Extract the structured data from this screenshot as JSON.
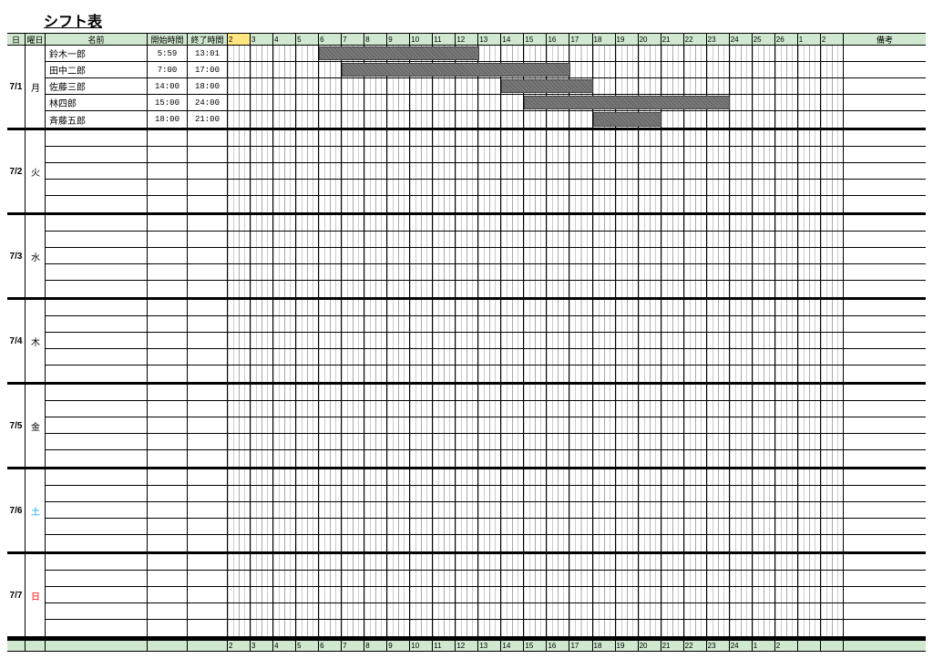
{
  "title": "シフト表",
  "headers": {
    "date": "日",
    "dow": "曜日",
    "name": "名前",
    "start": "開始時間",
    "end": "終了時間",
    "remark": "備考"
  },
  "timeline": {
    "start_hour": 2,
    "end_hour": 26,
    "hour_labels": [
      "2",
      "3",
      "4",
      "5",
      "6",
      "7",
      "8",
      "9",
      "10",
      "11",
      "12",
      "13",
      "14",
      "15",
      "16",
      "17",
      "18",
      "19",
      "20",
      "21",
      "22",
      "23",
      "24",
      "25",
      "26",
      "1",
      "2"
    ],
    "footer_labels": [
      "2",
      "3",
      "4",
      "5",
      "6",
      "7",
      "8",
      "9",
      "10",
      "11",
      "12",
      "13",
      "14",
      "15",
      "16",
      "17",
      "18",
      "19",
      "20",
      "21",
      "22",
      "23",
      "24",
      "1",
      "2"
    ],
    "active_index": 0
  },
  "days": [
    {
      "date": "7/1",
      "dow": "月",
      "dow_class": "",
      "rows": [
        {
          "name": "鈴木一郎",
          "start": "5:59",
          "end": "13:01",
          "barStart": 5.98,
          "barEnd": 13.02
        },
        {
          "name": "田中二郎",
          "start": "7:00",
          "end": "17:00",
          "barStart": 7,
          "barEnd": 17
        },
        {
          "name": "佐藤三郎",
          "start": "14:00",
          "end": "18:00",
          "barStart": 14,
          "barEnd": 18
        },
        {
          "name": "林四郎",
          "start": "15:00",
          "end": "24:00",
          "barStart": 15,
          "barEnd": 24
        },
        {
          "name": "斉藤五郎",
          "start": "18:00",
          "end": "21:00",
          "barStart": 18,
          "barEnd": 21
        }
      ]
    },
    {
      "date": "7/2",
      "dow": "火",
      "dow_class": "",
      "rows": [
        {},
        {},
        {},
        {},
        {}
      ]
    },
    {
      "date": "7/3",
      "dow": "水",
      "dow_class": "",
      "rows": [
        {},
        {},
        {},
        {},
        {}
      ]
    },
    {
      "date": "7/4",
      "dow": "木",
      "dow_class": "",
      "rows": [
        {},
        {},
        {},
        {},
        {}
      ]
    },
    {
      "date": "7/5",
      "dow": "金",
      "dow_class": "",
      "rows": [
        {},
        {},
        {},
        {},
        {}
      ]
    },
    {
      "date": "7/6",
      "dow": "土",
      "dow_class": "sat",
      "rows": [
        {},
        {},
        {},
        {},
        {}
      ]
    },
    {
      "date": "7/7",
      "dow": "日",
      "dow_class": "sun",
      "rows": [
        {},
        {},
        {},
        {},
        {}
      ]
    }
  ],
  "chart_data": {
    "type": "gantt",
    "title": "シフト表",
    "x_axis": {
      "unit": "hour",
      "min": 2,
      "max": 26
    },
    "series": [
      {
        "date": "7/1",
        "name": "鈴木一郎",
        "start": 5.98,
        "end": 13.02
      },
      {
        "date": "7/1",
        "name": "田中二郎",
        "start": 7,
        "end": 17
      },
      {
        "date": "7/1",
        "name": "佐藤三郎",
        "start": 14,
        "end": 18
      },
      {
        "date": "7/1",
        "name": "林四郎",
        "start": 15,
        "end": 24
      },
      {
        "date": "7/1",
        "name": "斉藤五郎",
        "start": 18,
        "end": 21
      }
    ]
  }
}
